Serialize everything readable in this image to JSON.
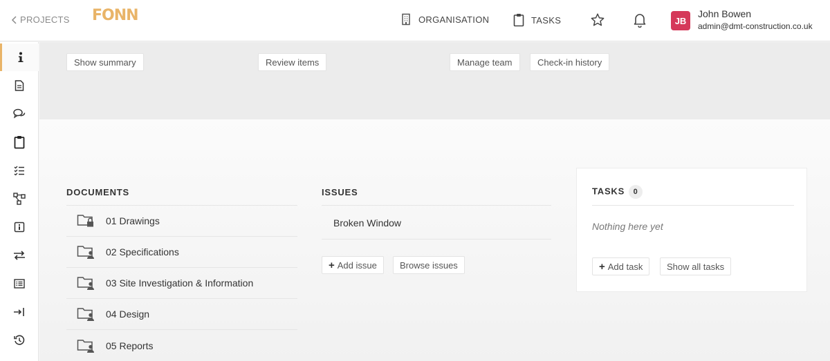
{
  "header": {
    "back_label": "PROJECTS",
    "logo_text": "FONN",
    "nav": [
      {
        "label": "ORGANISATION",
        "icon": "building-icon"
      },
      {
        "label": "TASKS",
        "icon": "clipboard-icon"
      }
    ],
    "user": {
      "initials": "JB",
      "name": "John Bowen",
      "email": "admin@dmt-construction.co.uk",
      "avatar_color": "#d5395a"
    }
  },
  "sidebar": {
    "items": [
      {
        "icon": "info-icon",
        "active": true
      },
      {
        "icon": "document-icon"
      },
      {
        "icon": "chat-icon"
      },
      {
        "icon": "clipboard-icon"
      },
      {
        "icon": "checklist-icon"
      },
      {
        "icon": "workflow-icon"
      },
      {
        "icon": "info-box-icon"
      },
      {
        "icon": "transfer-icon"
      },
      {
        "icon": "list-icon"
      },
      {
        "icon": "sign-in-icon"
      },
      {
        "icon": "history-icon"
      }
    ]
  },
  "actions": {
    "show_summary": "Show summary",
    "review_items": "Review items",
    "manage_team": "Manage team",
    "checkin_history": "Check-in history"
  },
  "documents": {
    "title": "DOCUMENTS",
    "items": [
      {
        "label": "01 Drawings",
        "folder": "locked"
      },
      {
        "label": "02 Specifications",
        "folder": "shared"
      },
      {
        "label": "03 Site Investigation & Information",
        "folder": "shared"
      },
      {
        "label": "04 Design",
        "folder": "shared"
      },
      {
        "label": "05 Reports",
        "folder": "shared"
      }
    ]
  },
  "issues": {
    "title": "ISSUES",
    "items": [
      {
        "label": "Broken Window"
      }
    ],
    "add_label": "Add issue",
    "browse_label": "Browse issues"
  },
  "tasks": {
    "title": "TASKS",
    "count": "0",
    "empty_text": "Nothing here yet",
    "add_label": "Add task",
    "show_all_label": "Show all tasks"
  },
  "colors": {
    "accent": "#e9b468",
    "avatar": "#d5395a"
  }
}
